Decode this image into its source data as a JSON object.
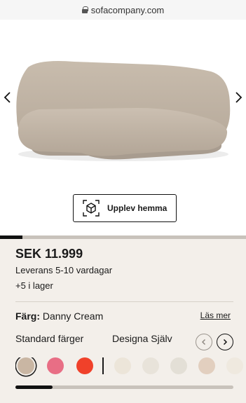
{
  "browser": {
    "url": "sofacompany.com"
  },
  "gallery": {
    "prev_icon": "chevron-left-icon",
    "next_icon": "chevron-right-icon",
    "progress": 0.09
  },
  "ar_button": {
    "label": "Upplev hemma",
    "icon": "ar-cube-icon"
  },
  "product": {
    "price": "SEK 11.999",
    "delivery": "Leverans 5-10 vardagar",
    "stock": "+5  i lager",
    "color_label": "Färg:",
    "color_value": " Danny Cream",
    "read_more": "Läs mer"
  },
  "tabs": {
    "standard": "Standard färger",
    "custom": "Designa Själv"
  },
  "swatches": [
    {
      "color": "#c9b6a3",
      "selected": true
    },
    {
      "color": "#e86e85",
      "selected": false
    },
    {
      "color": "#f0412a",
      "selected": false
    },
    {
      "color": "#ece5d9",
      "selected": false
    },
    {
      "color": "#e8e3da",
      "selected": false
    },
    {
      "color": "#e3dfd6",
      "selected": false
    },
    {
      "color": "#e2cfbf",
      "selected": false
    },
    {
      "color": "#efe9df",
      "selected": false
    }
  ],
  "swatch_progress": 0.17
}
